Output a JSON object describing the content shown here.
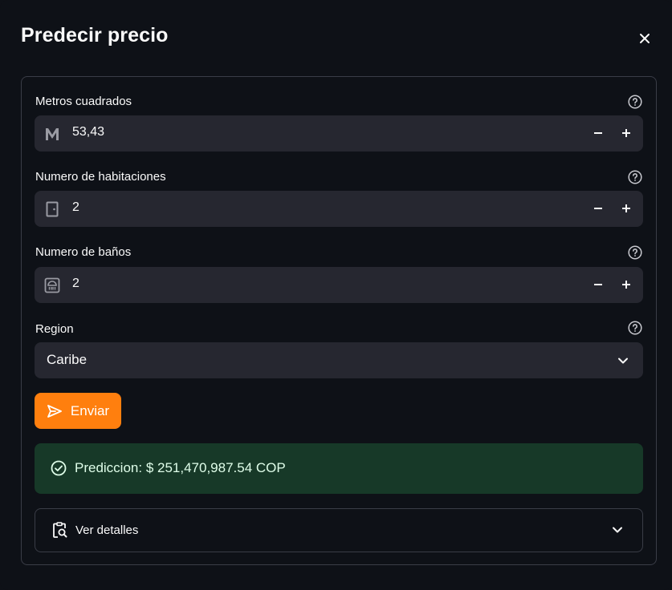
{
  "dialog": {
    "title": "Predecir precio",
    "close_icon": "close-icon"
  },
  "fields": [
    {
      "label": "Metros cuadrados",
      "value": "53,43",
      "icon": "letter-m-icon",
      "help_icon": "help-circle-icon",
      "minus": "−",
      "plus": "+"
    },
    {
      "label": "Numero de habitaciones",
      "value": "2",
      "icon": "door-icon",
      "help_icon": "help-circle-icon",
      "minus": "−",
      "plus": "+"
    },
    {
      "label": "Numero de baños",
      "value": "2",
      "icon": "bathtub-icon",
      "help_icon": "help-circle-icon",
      "minus": "−",
      "plus": "+"
    }
  ],
  "region": {
    "label": "Region",
    "selected": "Caribe",
    "help_icon": "help-circle-icon"
  },
  "submit": {
    "label": "Enviar",
    "icon": "send-icon",
    "color": "#ff7f0e"
  },
  "result": {
    "text": "Prediccion: $ 251,470,987.54 COP",
    "icon": "check-circle-icon",
    "color": "#173928"
  },
  "details": {
    "label": "Ver detalles",
    "icon": "clipboard-search-icon"
  },
  "colors": {
    "background": "#0e1117",
    "input_bg": "#262730",
    "border": "#3a3d47",
    "accent": "#ff7f0e"
  }
}
